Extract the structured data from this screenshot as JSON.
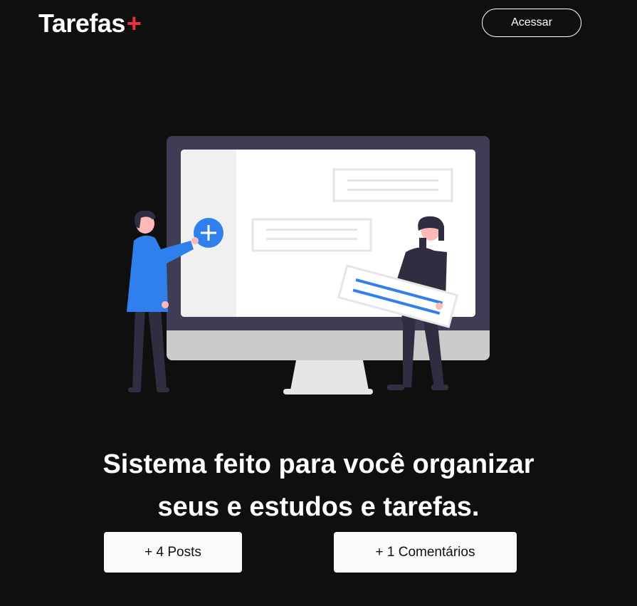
{
  "header": {
    "logo_text": "Tarefas",
    "logo_plus": "+",
    "login_label": "Acessar"
  },
  "hero": {
    "illustration": "person-adding-tasks-to-monitor",
    "headline_line1": "Sistema feito para você organizar",
    "headline_line2": "seus e estudos e tarefas."
  },
  "stats": {
    "posts_label": "+ 4 Posts",
    "comments_label": "+ 1 Comentários"
  },
  "colors": {
    "background": "#0f0f0f",
    "accent": "#ea3140",
    "illustration_blue": "#2f80ed",
    "monitor_frame": "#3f3d56",
    "button_background": "#fafafa"
  }
}
